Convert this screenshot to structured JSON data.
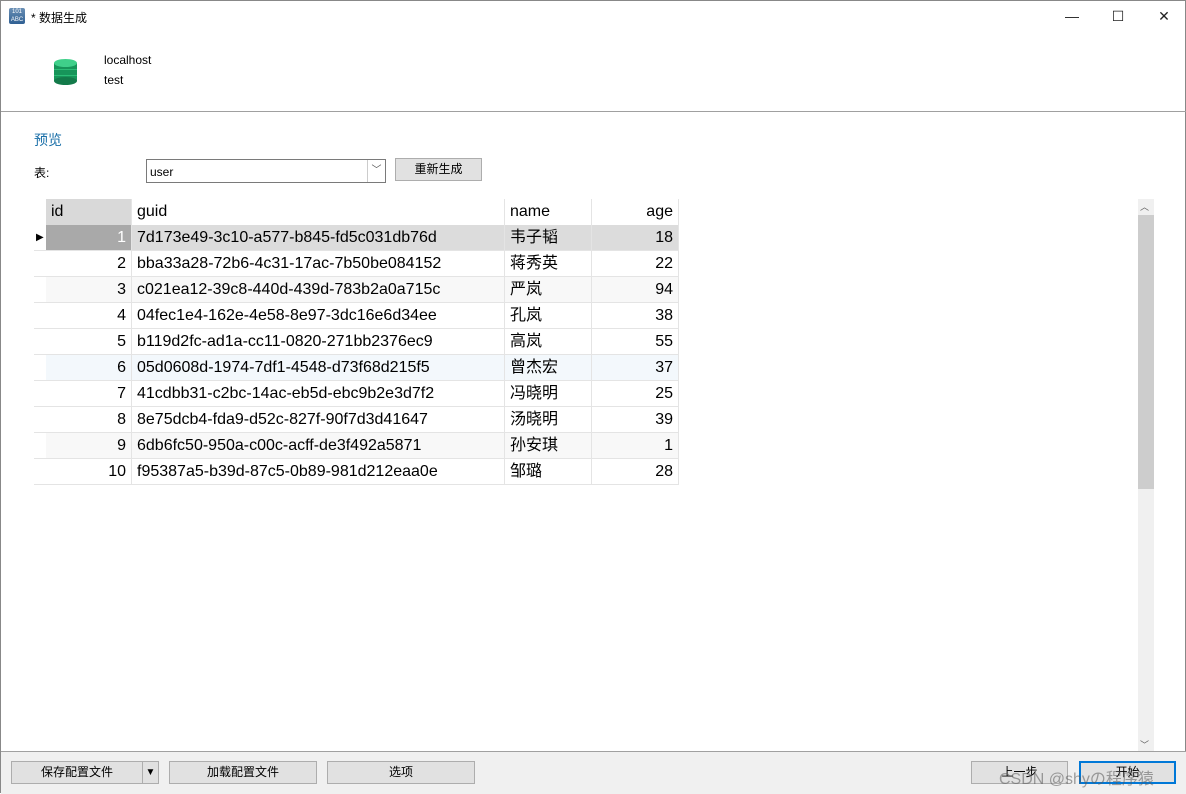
{
  "window": {
    "title": "* 数据生成",
    "minimize": "—",
    "maximize": "☐",
    "close": "✕"
  },
  "connection": {
    "host": "localhost",
    "database": "test"
  },
  "preview": {
    "heading": "预览",
    "table_label": "表:",
    "table_value": "user",
    "regenerate": "重新生成"
  },
  "grid": {
    "columns": [
      "id",
      "guid",
      "name",
      "age"
    ],
    "rows": [
      [
        "1",
        "7d173e49-3c10-a577-b845-fd5c031db76d",
        "韦子韬",
        "18"
      ],
      [
        "2",
        "bba33a28-72b6-4c31-17ac-7b50be084152",
        "蒋秀英",
        "22"
      ],
      [
        "3",
        "c021ea12-39c8-440d-439d-783b2a0a715c",
        "严岚",
        "94"
      ],
      [
        "4",
        "04fec1e4-162e-4e58-8e97-3dc16e6d34ee",
        "孔岚",
        "38"
      ],
      [
        "5",
        "b119d2fc-ad1a-cc11-0820-271bb2376ec9",
        "高岚",
        "55"
      ],
      [
        "6",
        "05d0608d-1974-7df1-4548-d73f68d215f5",
        "曾杰宏",
        "37"
      ],
      [
        "7",
        "41cdbb31-c2bc-14ac-eb5d-ebc9b2e3d7f2",
        "冯晓明",
        "25"
      ],
      [
        "8",
        "8e75dcb4-fda9-d52c-827f-90f7d3d41647",
        "汤晓明",
        "39"
      ],
      [
        "9",
        "6db6fc50-950a-c00c-acff-de3f492a5871",
        "孙安琪",
        "1"
      ],
      [
        "10",
        "f95387a5-b39d-87c5-0b89-981d212eaa0e",
        "邹璐",
        "28"
      ]
    ]
  },
  "footer": {
    "save_config": "保存配置文件",
    "load_config": "加载配置文件",
    "options": "选项",
    "back": "上一步",
    "start": "开始",
    "watermark": "CSDN @shyの程序猿"
  },
  "colors": {
    "accent": "#1a6fa8",
    "db_icon": "#1fa463",
    "selected": "#dcdcdc"
  }
}
